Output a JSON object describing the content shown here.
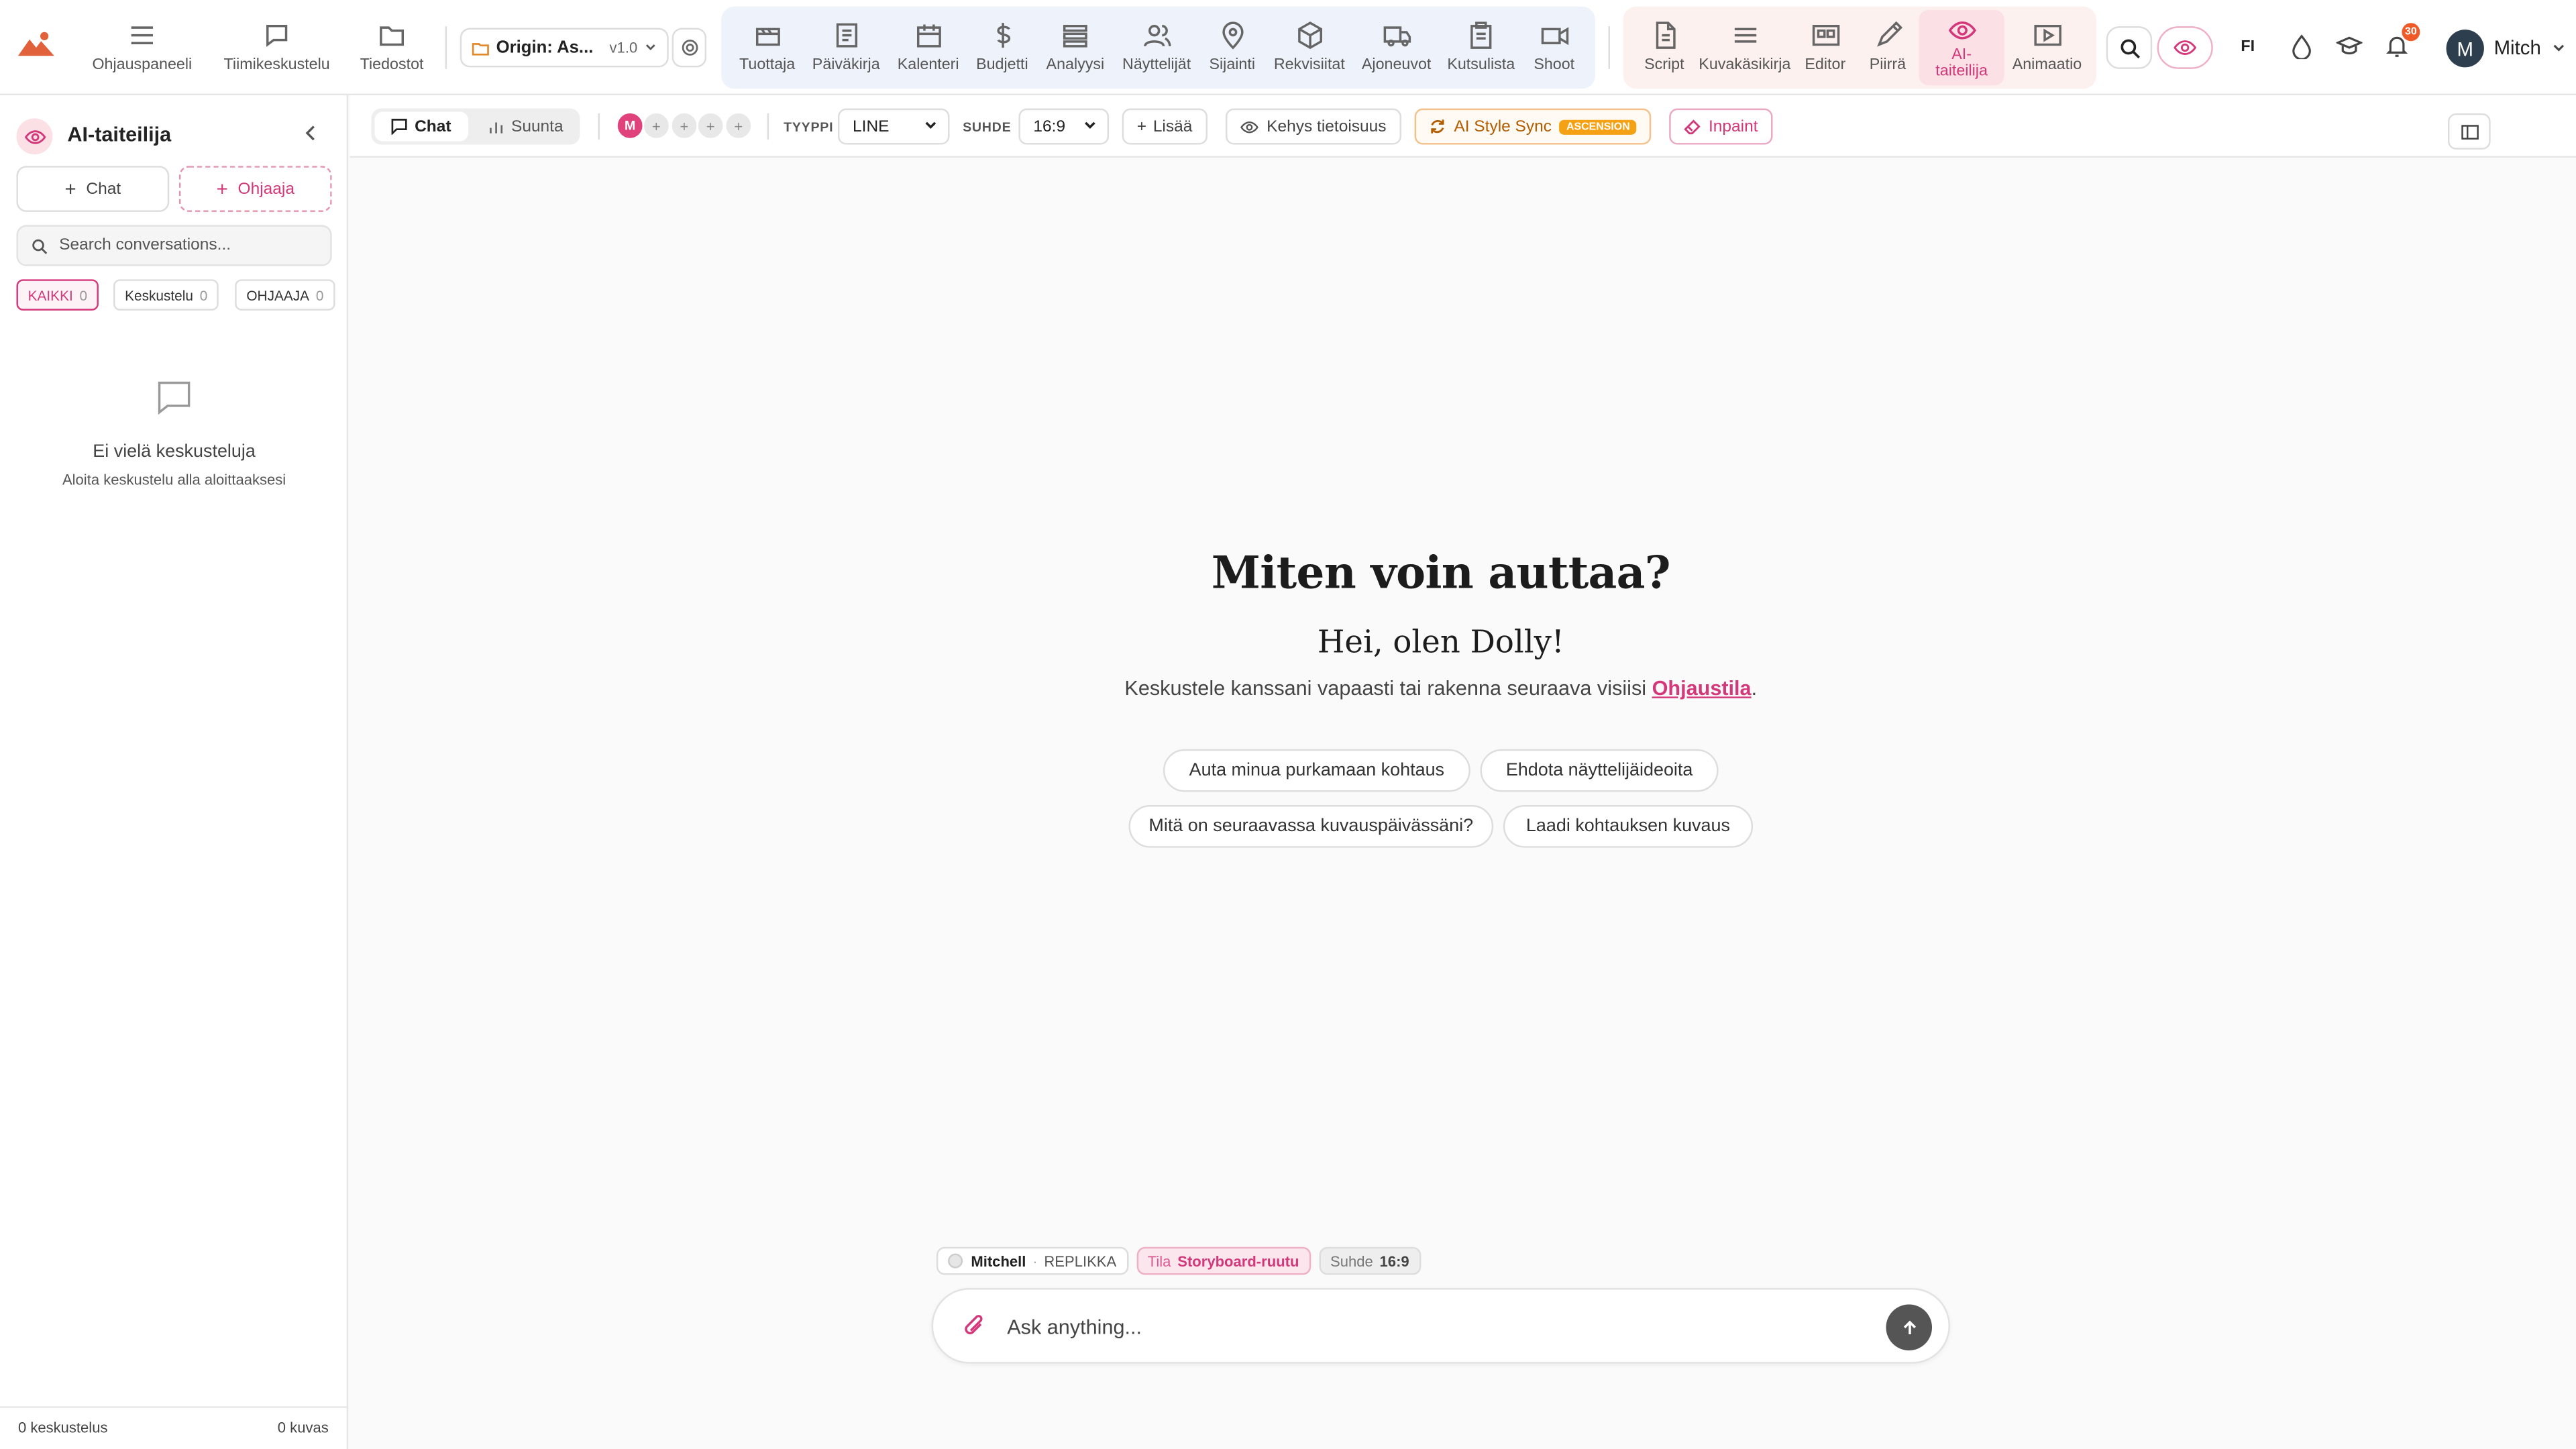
{
  "topbar": {
    "nav_left": [
      {
        "label": "Ohjauspaneeli",
        "icon": "menu-icon"
      },
      {
        "label": "Tiimikeskustelu",
        "icon": "chat-bubble-icon"
      },
      {
        "label": "Tiedostot",
        "icon": "folder-icon"
      }
    ],
    "project": {
      "name": "Origin: As...",
      "version": "v1.0"
    },
    "production_tabs": [
      {
        "label": "Tuottaja",
        "icon": "clapperboard-icon"
      },
      {
        "label": "Päiväkirja",
        "icon": "notebook-icon"
      },
      {
        "label": "Kalenteri",
        "icon": "calendar-icon"
      },
      {
        "label": "Budjetti",
        "icon": "dollar-icon"
      },
      {
        "label": "Analyysi",
        "icon": "stack-icon"
      },
      {
        "label": "Näyttelijät",
        "icon": "users-icon"
      },
      {
        "label": "Sijainti",
        "icon": "map-pin-icon"
      },
      {
        "label": "Rekvisiitat",
        "icon": "box-icon"
      },
      {
        "label": "Ajoneuvot",
        "icon": "truck-icon"
      },
      {
        "label": "Kutsulista",
        "icon": "clipboard-icon"
      },
      {
        "label": "Shoot",
        "icon": "video-camera-icon"
      }
    ],
    "creative_tabs": [
      {
        "label": "Script",
        "icon": "document-icon"
      },
      {
        "label": "Kuvakäsikirja",
        "icon": "lines-icon"
      },
      {
        "label": "Editor",
        "icon": "editor-icon"
      },
      {
        "label": "Piirrä",
        "icon": "pencil-icon"
      },
      {
        "label": "AI-taiteilija",
        "icon": "eye-icon",
        "active": true
      },
      {
        "label": "Animaatio",
        "icon": "play-screen-icon"
      }
    ],
    "language": "FI",
    "notifications_count": "30",
    "user": {
      "initial": "M",
      "name": "Mitch"
    }
  },
  "sidebar": {
    "title": "AI-taiteilija",
    "new_chat_label": "Chat",
    "new_director_label": "Ohjaaja",
    "search_placeholder": "Search conversations...",
    "filters": [
      {
        "label": "KAIKKI",
        "count": "0",
        "active": true
      },
      {
        "label": "Keskustelu",
        "count": "0"
      },
      {
        "label": "OHJAAJA",
        "count": "0"
      }
    ],
    "empty_title": "Ei vielä keskusteluja",
    "empty_subtitle": "Aloita keskustelu alla aloittaaksesi",
    "footer_left": "0 keskustelus",
    "footer_right": "0 kuvas"
  },
  "toolbar": {
    "mode_chat": "Chat",
    "mode_direction": "Suunta",
    "participant_initial": "M",
    "type_label": "TYYPPI",
    "type_value": "LINE",
    "ratio_label": "SUHDE",
    "ratio_value": "16:9",
    "add_label": "Lisää",
    "frame_info_label": "Kehys tietoisuus",
    "style_sync_label": "AI Style Sync",
    "style_sync_badge": "ASCENSION",
    "inpaint_label": "Inpaint"
  },
  "main": {
    "heading": "Miten voin auttaa?",
    "greeting": "Hei, olen Dolly!",
    "description_prefix": "Keskustele kanssani vapaasti tai rakenna seuraava visiisi ",
    "description_link": "Ohjaustila",
    "description_suffix": ".",
    "suggestions": [
      "Auta minua purkamaan kohtaus",
      "Ehdota näyttelijäideoita",
      "Mitä on seuraavassa kuvauspäivässäni?",
      "Laadi kohtauksen kuvaus"
    ],
    "status": {
      "user_name": "Mitchell",
      "user_role": "REPLIKKA",
      "mode_label": "Tila",
      "mode_value": "Storyboard-ruutu",
      "ratio_label": "Suhde",
      "ratio_value": "16:9"
    },
    "composer_placeholder": "Ask anything..."
  },
  "colors": {
    "accent": "#d4377a",
    "nav_blue_bg": "#eef3fb",
    "nav_pink_bg": "#fdf1ef",
    "style_sync": "#f5a114"
  }
}
